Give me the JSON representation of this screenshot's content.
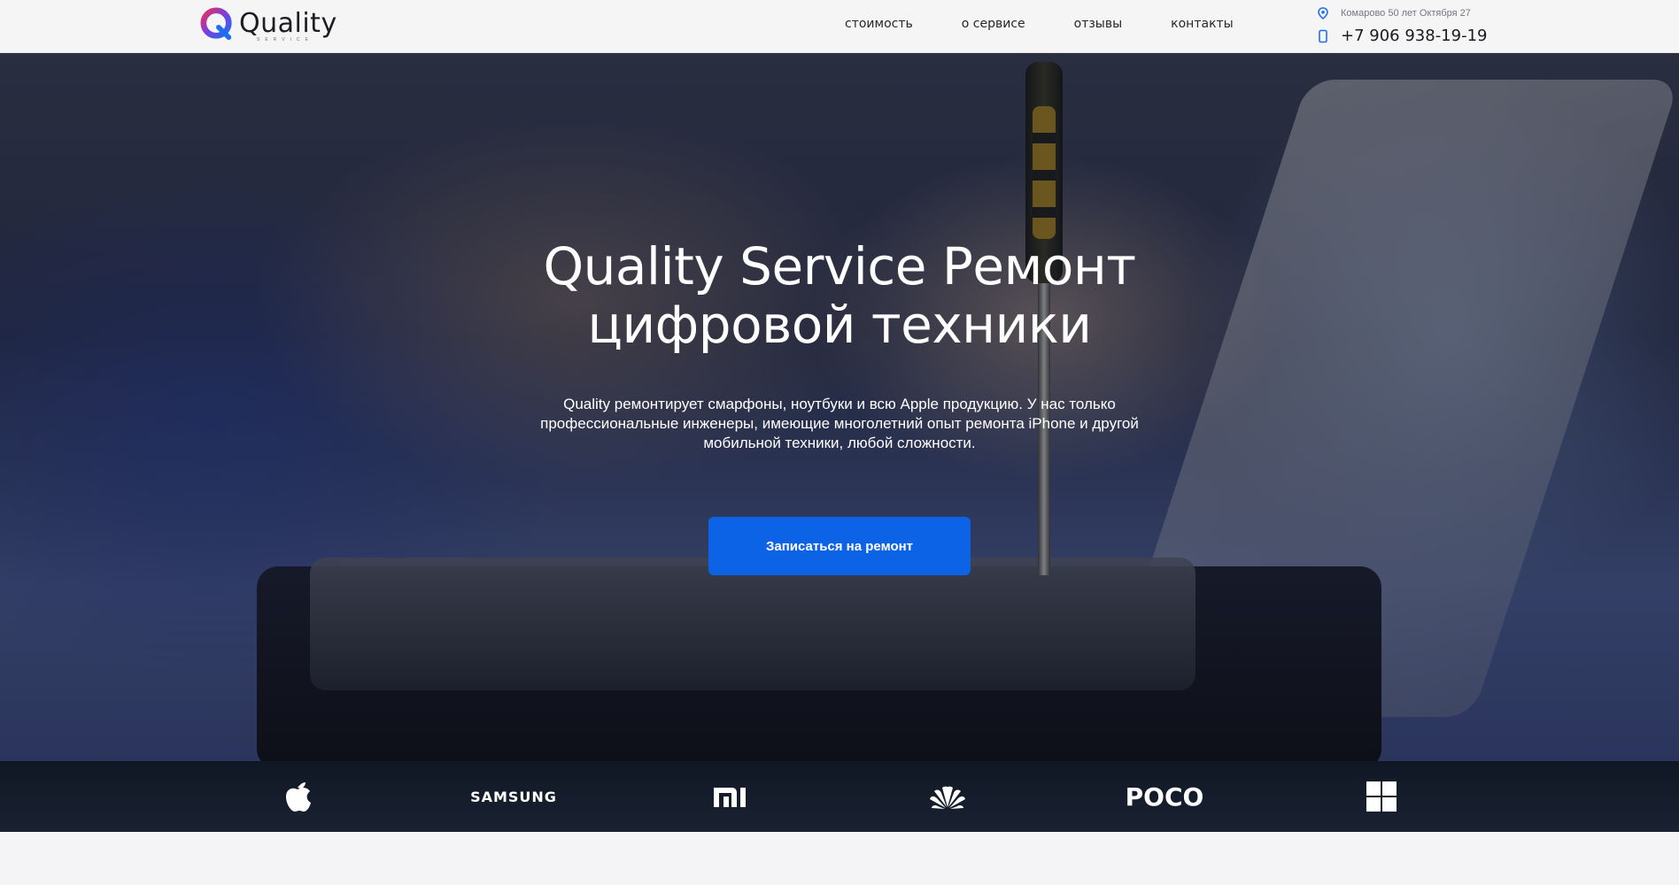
{
  "header": {
    "logo_text": "Quality",
    "logo_sub": "SERVICE",
    "nav": [
      {
        "label": "стоимость"
      },
      {
        "label": "о сервисе"
      },
      {
        "label": "отзывы"
      },
      {
        "label": "контакты"
      }
    ],
    "address": "Комарово 50 лет Октября 27",
    "phone": "+7 906 938-19-19"
  },
  "hero": {
    "title_line1": "Quality Service Ремонт",
    "title_line2": "цифровой техники",
    "description": "Quality ремонтирует смарфоны, ноутбуки и всю Apple продукцию. У нас только профессиональные инженеры, имеющие многолетний опыт ремонта iPhone и другой мобильной техники, любой сложности.",
    "cta_label": "Записаться на ремонт"
  },
  "brands": [
    {
      "name": "apple-icon"
    },
    {
      "name": "samsung",
      "label": "SAMSUNG"
    },
    {
      "name": "xiaomi-icon"
    },
    {
      "name": "huawei-icon"
    },
    {
      "name": "poco",
      "label": "POCO"
    },
    {
      "name": "windows-icon"
    }
  ],
  "colors": {
    "accent": "#0d63e6",
    "brand_bar": "#131b29"
  }
}
